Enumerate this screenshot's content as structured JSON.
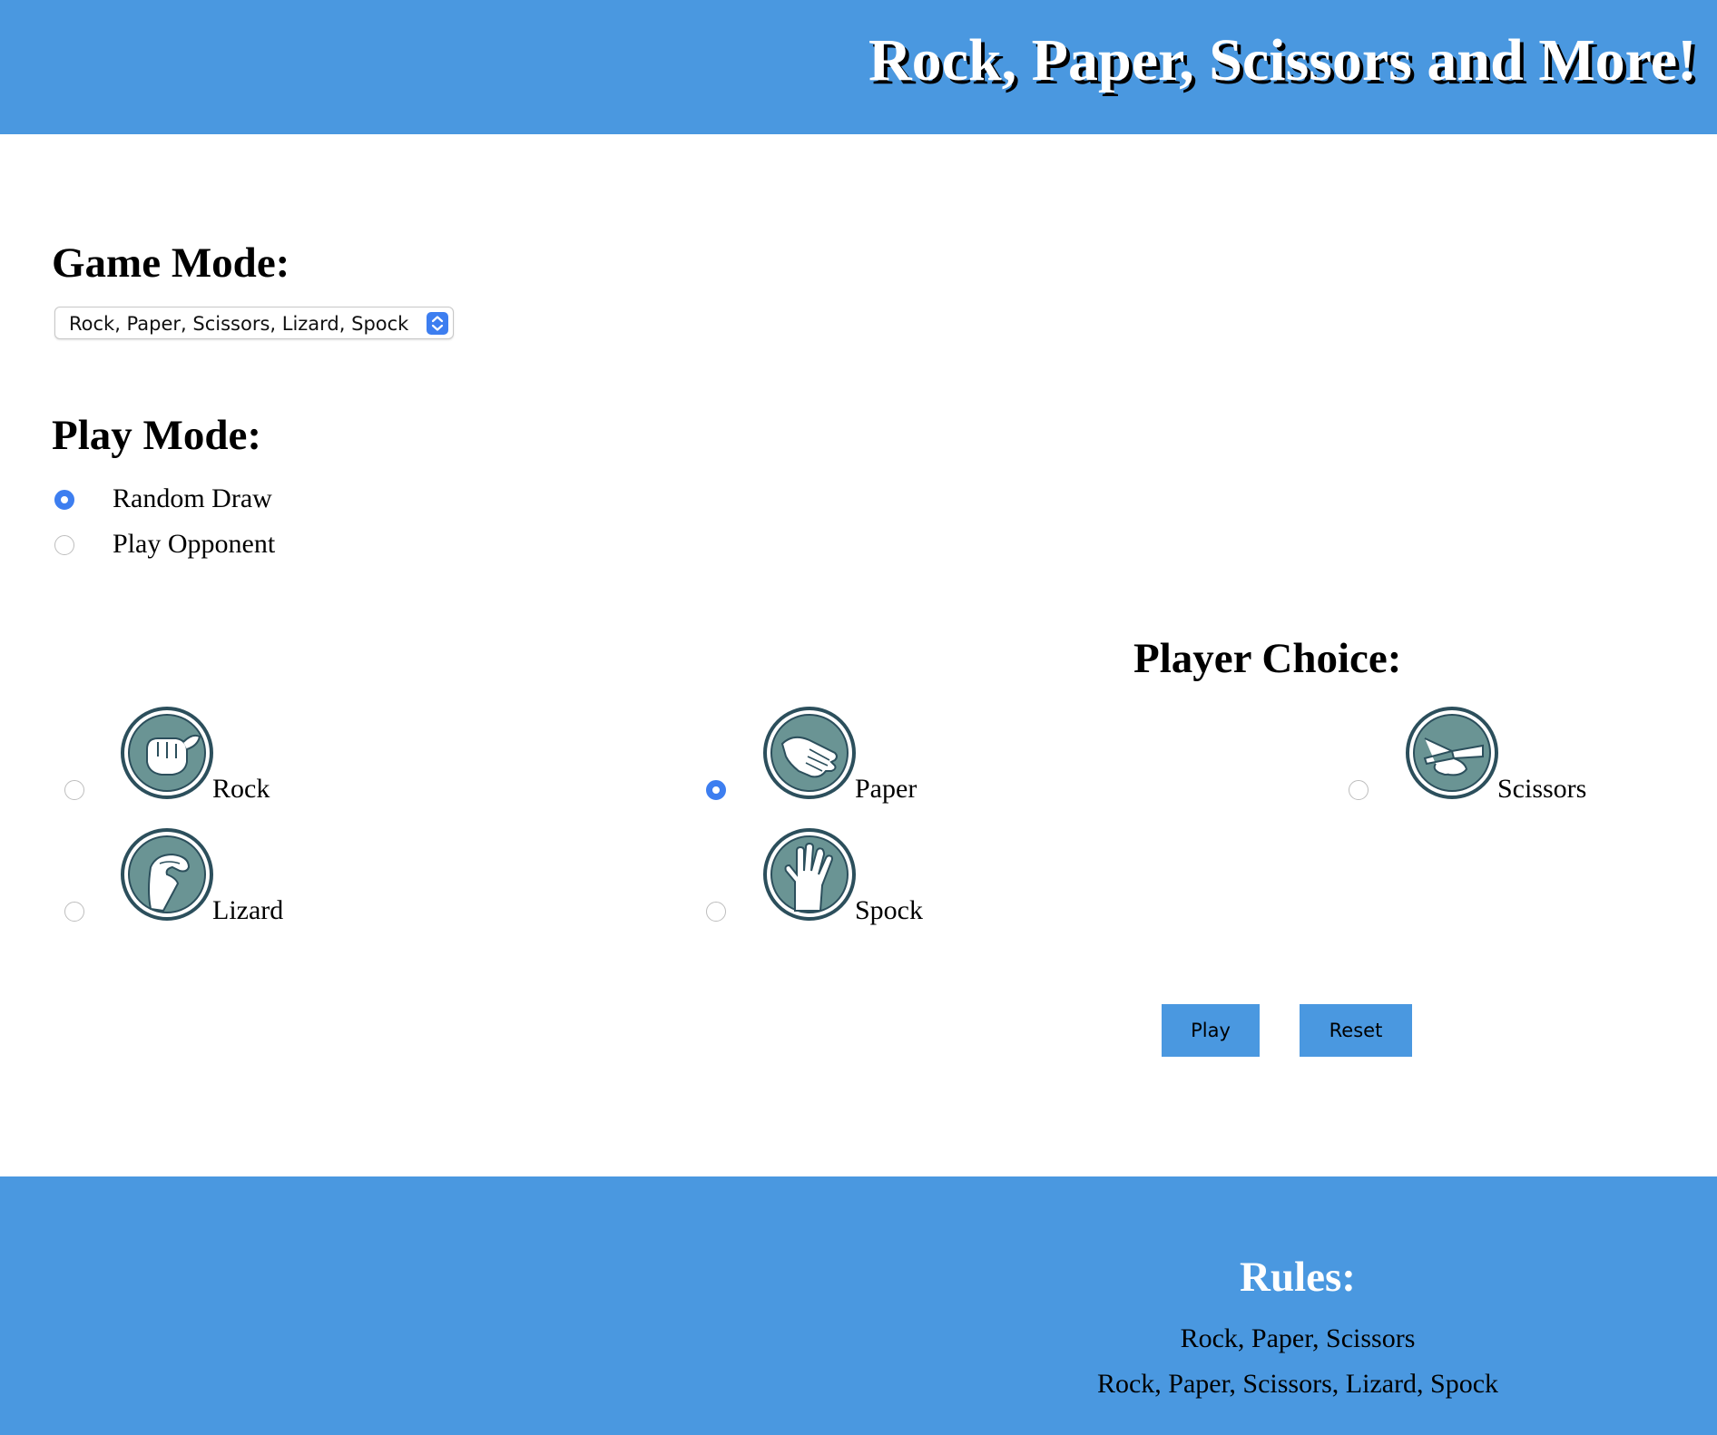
{
  "header": {
    "title": "Rock, Paper, Scissors and More!"
  },
  "game_mode": {
    "heading": "Game Mode:",
    "selected": "Rock, Paper, Scissors, Lizard, Spock"
  },
  "play_mode": {
    "heading": "Play Mode:",
    "options": [
      {
        "label": "Random Draw",
        "checked": true
      },
      {
        "label": "Play Opponent",
        "checked": false
      }
    ]
  },
  "player_choice": {
    "heading": "Player Choice:",
    "choices": [
      {
        "label": "Rock",
        "icon": "rock-hand-icon",
        "checked": false
      },
      {
        "label": "Paper",
        "icon": "paper-hand-icon",
        "checked": true
      },
      {
        "label": "Scissors",
        "icon": "scissors-hand-icon",
        "checked": false
      },
      {
        "label": "Lizard",
        "icon": "lizard-hand-icon",
        "checked": false
      },
      {
        "label": "Spock",
        "icon": "spock-hand-icon",
        "checked": false
      }
    ]
  },
  "actions": {
    "play_label": "Play",
    "reset_label": "Reset"
  },
  "rules": {
    "heading": "Rules:",
    "items": [
      "Rock, Paper, Scissors",
      "Rock, Paper, Scissors, Lizard, Spock"
    ]
  },
  "colors": {
    "header_bg": "#4a98e0",
    "footer_bg": "#4a98e0",
    "radio_checked": "#3d7ef0",
    "icon_fill": "#6a9494",
    "icon_ring": "#2c4f5c"
  }
}
